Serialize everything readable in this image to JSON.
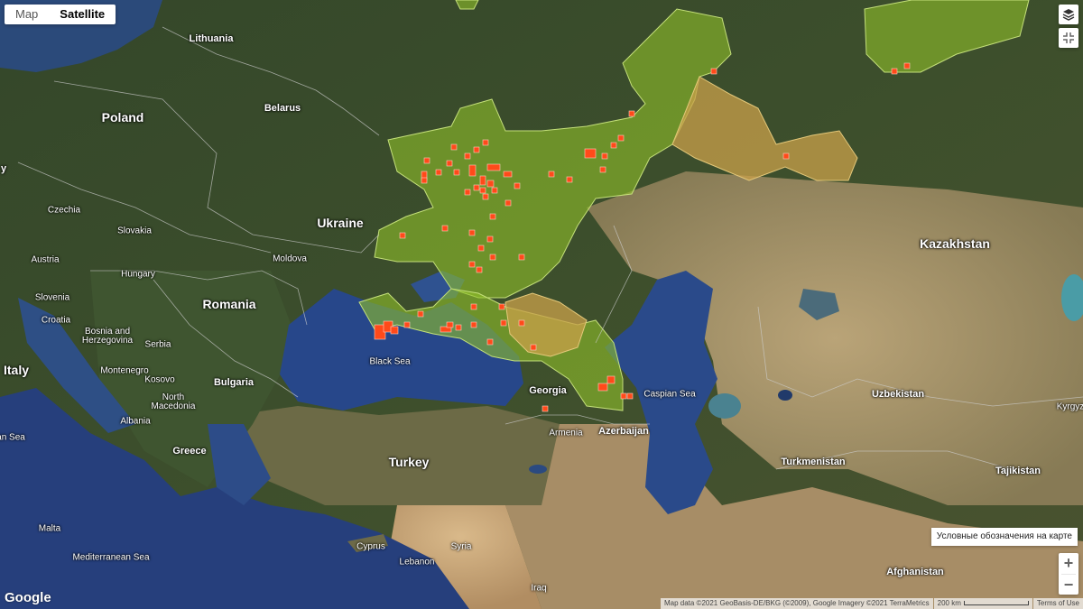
{
  "map_controls": {
    "tab_map": "Map",
    "tab_satellite": "Satellite",
    "zoom_in": "+",
    "zoom_out": "−"
  },
  "legend_button": "Условные обозначения на карте",
  "footer": {
    "map_data": "Map data ©2021 GeoBasis-DE/BKG (©2009), Google Imagery ©2021 TerraMetrics",
    "scale": "200 km",
    "terms": "Terms of Use"
  },
  "logo": "Google",
  "labels": {
    "lithuania": "Lithuania",
    "poland": "Poland",
    "belarus": "Belarus",
    "ukraine": "Ukraine",
    "kazakhstan": "Kazakhstan",
    "czechia": "Czechia",
    "slovakia": "Slovakia",
    "austria": "Austria",
    "hungary": "Hungary",
    "moldova": "Moldova",
    "romania": "Romania",
    "slovenia": "Slovenia",
    "croatia": "Croatia",
    "bosnia": "Bosnia and Herzegovina",
    "serbia": "Serbia",
    "montenegro": "Montenegro",
    "kosovo": "Kosovo",
    "bulgaria": "Bulgaria",
    "north_macedonia": "North Macedonia",
    "albania": "Albania",
    "italy": "Italy",
    "greece": "Greece",
    "turkey": "Turkey",
    "black_sea": "Black Sea",
    "georgia": "Georgia",
    "armenia": "Armenia",
    "azerbaijan": "Azerbaijan",
    "caspian_sea": "Caspian Sea",
    "uzbekistan": "Uzbekistan",
    "turkmenistan": "Turkmenistan",
    "tajikistan": "Tajikistan",
    "kyrgyz": "Kyrgyz",
    "afghanistan": "Afghanistan",
    "syria": "Syria",
    "cyprus": "Cyprus",
    "lebanon": "Lebanon",
    "iraq": "Iraq",
    "malta": "Malta",
    "mediterranean": "Mediterranean Sea",
    "an_sea": "an Sea",
    "y": "y"
  },
  "colors": {
    "region_green": "#8fbf2a",
    "region_orange": "#c9a04a",
    "marker": "#ff4a1a"
  }
}
